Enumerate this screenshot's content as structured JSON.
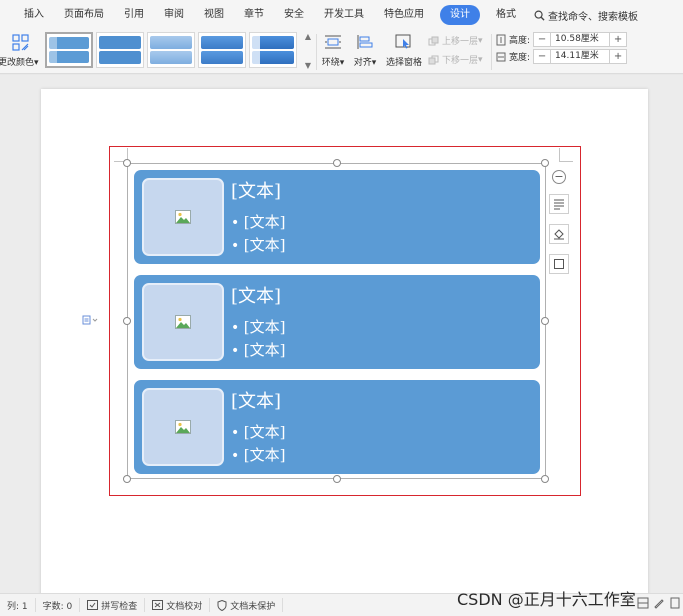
{
  "menu": {
    "items": [
      "插入",
      "页面布局",
      "引用",
      "审阅",
      "视图",
      "章节",
      "安全",
      "开发工具",
      "特色应用",
      "设计",
      "格式"
    ],
    "active": "设计",
    "search_label": "查找命令、搜索模板"
  },
  "ribbon": {
    "change_color_label": "更改颜色",
    "wrap_label": "环绕",
    "align_label": "对齐",
    "selection_pane_label": "选择窗格",
    "bring_forward_label": "上移一层",
    "send_backward_label": "下移一层",
    "height_label": "高度:",
    "height_value": "10.58厘米",
    "width_label": "宽度:",
    "width_value": "14.11厘米",
    "minus": "−",
    "plus": "+",
    "dropdown_caret": "▾"
  },
  "smartart": {
    "cards": [
      {
        "title": "[文本]",
        "bullets": [
          "[文本]",
          "[文本]"
        ]
      },
      {
        "title": "[文本]",
        "bullets": [
          "[文本]",
          "[文本]"
        ]
      },
      {
        "title": "[文本]",
        "bullets": [
          "[文本]",
          "[文本]"
        ]
      }
    ],
    "collapse_symbol": "−"
  },
  "status": {
    "column": "列: 1",
    "word_count": "字数: 0",
    "spell_check": "拼写检查",
    "proofread": "文档校对",
    "protection": "文档未保护"
  },
  "watermark": "CSDN @正月十六工作室",
  "colors": {
    "accent": "#3f80e8",
    "card": "#5b9bd5",
    "thumb": "#c6d7ee",
    "frame": "#d7262e"
  },
  "icons": [
    "change-color-icon",
    "search-icon",
    "wrap-icon",
    "align-icon",
    "selection-pane-icon",
    "bring-forward-icon",
    "send-backward-icon",
    "height-icon",
    "width-icon",
    "image-placeholder-icon",
    "layout-options-icon",
    "fill-icon",
    "outline-icon",
    "spell-check-icon",
    "proofread-icon",
    "shield-icon",
    "anchor-icon"
  ]
}
